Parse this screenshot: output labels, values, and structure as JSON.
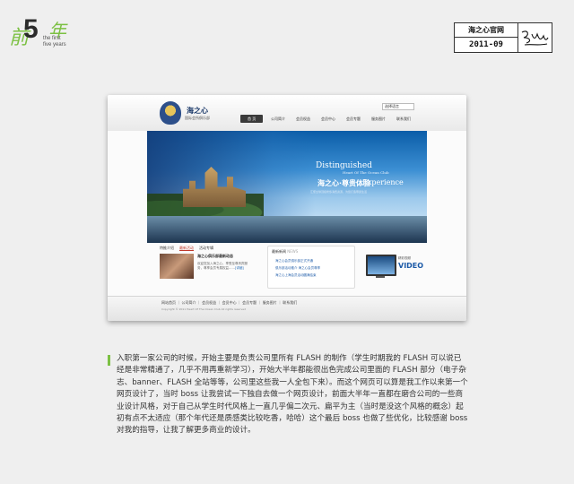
{
  "brand": {
    "char_a": "前",
    "big": "5",
    "char_b": "年",
    "sub": "the first\nfive years"
  },
  "stamp": {
    "title": "海之心官网",
    "date": "2011-09"
  },
  "site": {
    "title": "海之心",
    "subtitle": "国际会所俱乐部",
    "lang": "选择语言",
    "nav": [
      "首 页",
      "公司简介",
      "会员权益",
      "会员中心",
      "会员专题",
      "服务图片",
      "联系我们"
    ],
    "banner": {
      "title": "Distinguished",
      "subtitle": "Heart Of The Ocean Club",
      "cn": "海之心·尊贵体验",
      "en": "Experience",
      "line": "汇聚全球顶级奢侈消费资源，为您打造尊贵生活"
    },
    "tabs": [
      "特推介绍",
      "最新活动",
      "活动专辑"
    ],
    "news": {
      "title": "海之心俱乐部最新动态",
      "desc": "欢迎您加入海之心，享受至尊贵宾服务，尊享会员专属权益……",
      "more": "[详细]"
    },
    "latest": {
      "heading": "最新新闻",
      "heading_en": "NEWS",
      "items": [
        "海之心会员俱乐部正式开通",
        "俱乐部活动推介 海之心会员尊享",
        "海之心上海会员活动圆满结束"
      ]
    },
    "video": {
      "label": "精彩视频",
      "word": "VIDEO"
    },
    "footer": {
      "links": "网站首页 ｜ 公司简介 ｜ 会员权益 ｜ 会员中心 ｜ 会员专题 ｜ 服务图片 ｜ 联系我们",
      "copy": "Copyright © 2011 Heart Of The Ocean Club All rights reserved"
    }
  },
  "description": "入职第一家公司的时候，开始主要是负责公司里所有 FLASH 的制作（学生时期我的 FLASH 可以说已经是非常精通了，几乎不用再重新学习），开始大半年都能很出色完成公司里面的 FLASH 部分（电子杂志、banner、FLASH 全站等等，公司里这些我一人全包下来）。而这个网页可以算是我工作以来第一个网页设计了，当时 boss 让我尝试一下独自去做一个网页设计，前面大半年一直都在磨合公司的一些商业设计风格，对于自己从学生时代风格上一直几乎偏二次元、扁平为主（当时是没这个风格的概念）起初有点不太适应（那个年代还是质感类比较吃香，哈哈）这个最后 boss 也做了些优化，比较感谢 boss 对我的指导，让我了解更多商业的设计。"
}
